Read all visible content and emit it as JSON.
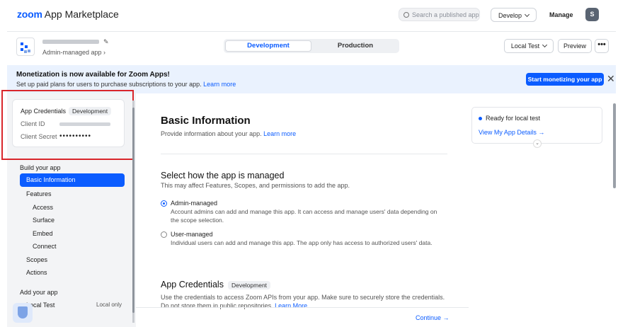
{
  "topbar": {
    "logo_brand": "zoom",
    "logo_text": "App Marketplace",
    "search_placeholder": "Search a published app",
    "develop_label": "Develop",
    "manage_label": "Manage",
    "avatar_initial": "S"
  },
  "app": {
    "subtitle": "Admin-managed app ›",
    "tab_development": "Development",
    "tab_production": "Production",
    "local_test_label": "Local Test",
    "preview_label": "Preview",
    "more_label": "•••"
  },
  "banner": {
    "title": "Monetization is now available for Zoom Apps!",
    "text": "Set up paid plans for users to purchase subscriptions to your app.",
    "link": "Learn more",
    "button": "Start monetizing your app",
    "close": "✕"
  },
  "credentials_card": {
    "title": "App Credentials",
    "badge": "Development",
    "client_id_label": "Client ID",
    "client_secret_label": "Client Secret",
    "client_secret_value": "••••••••••"
  },
  "sidebar": {
    "build_heading": "Build your app",
    "basic_information": "Basic Information",
    "features": "Features",
    "access": "Access",
    "surface": "Surface",
    "embed": "Embed",
    "connect": "Connect",
    "scopes": "Scopes",
    "actions": "Actions",
    "add_heading": "Add your app",
    "local_test": "Local Test",
    "local_only": "Local only"
  },
  "main": {
    "title": "Basic Information",
    "subtitle": "Provide information about your app.",
    "subtitle_link": "Learn more",
    "manage_heading": "Select how the app is managed",
    "manage_sub": "This may affect Features, Scopes, and permissions to add the app.",
    "admin_title": "Admin-managed",
    "admin_desc": "Account admins can add and manage this app. It can access and manage users' data depending on the scope selection.",
    "user_title": "User-managed",
    "user_desc": "Individual users can add and manage this app. The app only has access to authorized users' data.",
    "cred_heading": "App Credentials",
    "cred_badge": "Development",
    "cred_desc": "Use the credentials to access Zoom APIs from your app. Make sure to securely store the credentials. Do not store them in public repositories.",
    "cred_link": "Learn More",
    "continue": "Continue →"
  },
  "status": {
    "ready": "Ready for local test",
    "details": "View My App Details →"
  },
  "colors": {
    "accent": "#0b5cff",
    "highlight_box": "#d9262b",
    "banner_bg": "#eaf2fe"
  },
  "icons": [
    "search-icon",
    "chevron-down-icon",
    "pencil-icon",
    "app-icon",
    "close-icon",
    "shield-icon",
    "expand-icon"
  ]
}
